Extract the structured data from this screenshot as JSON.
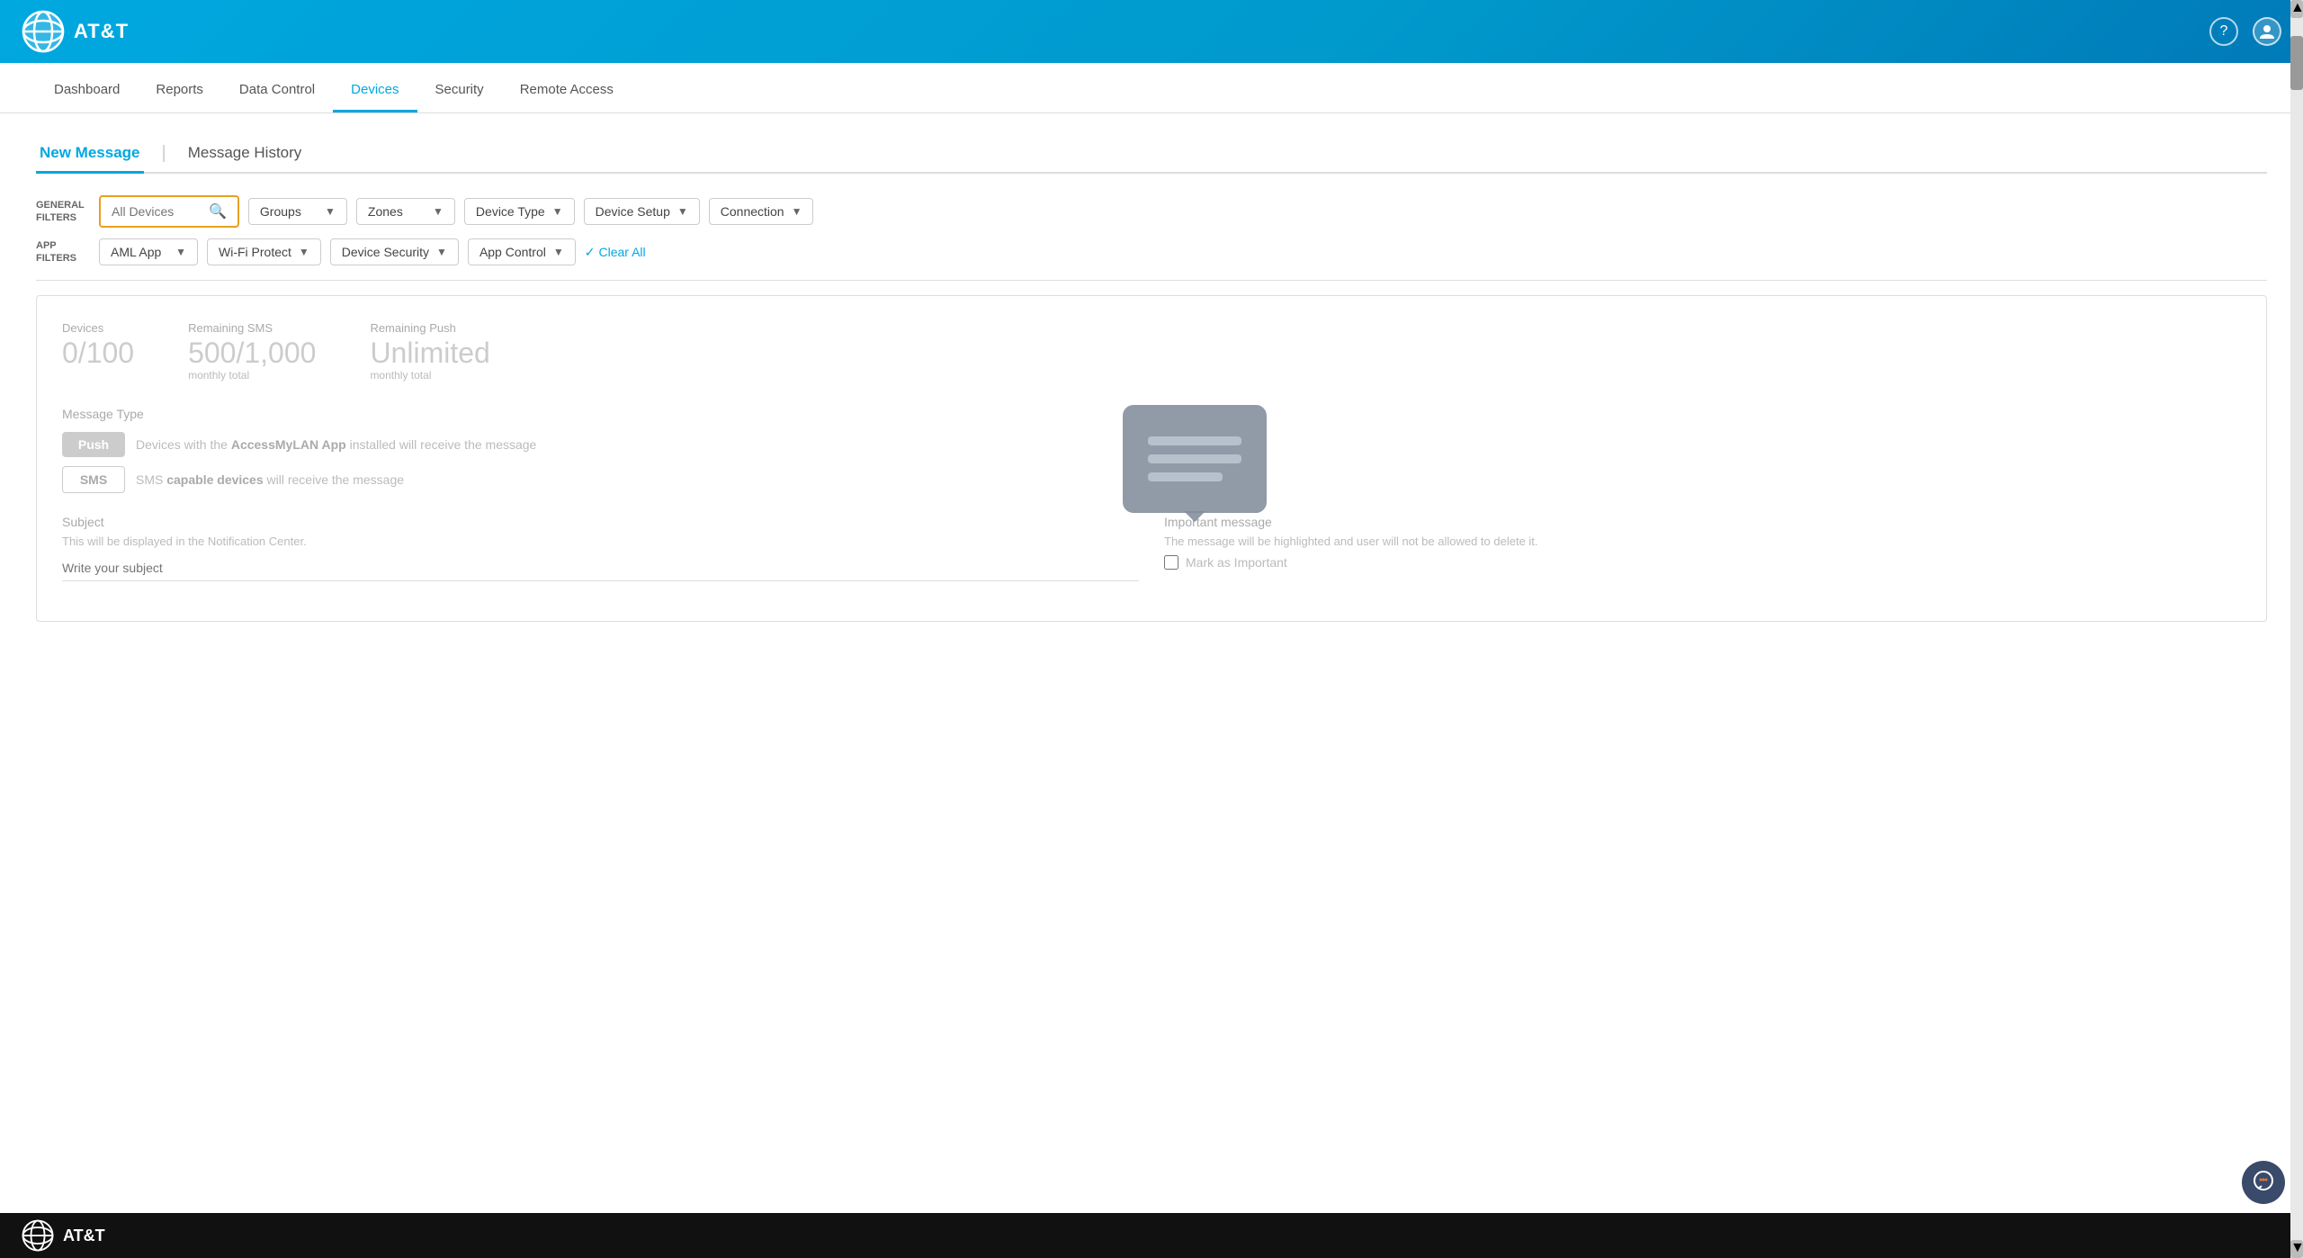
{
  "header": {
    "brand": "AT&T",
    "help_icon": "?",
    "user_icon": "👤"
  },
  "navbar": {
    "items": [
      {
        "label": "Dashboard",
        "active": false
      },
      {
        "label": "Reports",
        "active": false
      },
      {
        "label": "Data Control",
        "active": false
      },
      {
        "label": "Devices",
        "active": true
      },
      {
        "label": "Security",
        "active": false
      },
      {
        "label": "Remote Access",
        "active": false
      }
    ]
  },
  "tabs": [
    {
      "label": "New Message",
      "active": true
    },
    {
      "label": "Message History",
      "active": false
    }
  ],
  "filters": {
    "general_label": "GENERAL FILTERS",
    "app_label": "APP FILTERS",
    "search_placeholder": "All Devices",
    "general_dropdowns": [
      {
        "label": "Groups"
      },
      {
        "label": "Zones"
      },
      {
        "label": "Device Type"
      },
      {
        "label": "Device Setup"
      },
      {
        "label": "Connection"
      }
    ],
    "app_dropdowns": [
      {
        "label": "AML App"
      },
      {
        "label": "Wi-Fi Protect"
      },
      {
        "label": "Device Security"
      },
      {
        "label": "App Control"
      }
    ],
    "clear_all": "Clear All"
  },
  "stats": [
    {
      "label": "Devices",
      "value": "0/100",
      "sub": ""
    },
    {
      "label": "Remaining SMS",
      "value": "500/1,000",
      "sub": "monthly total"
    },
    {
      "label": "Remaining Push",
      "value": "Unlimited",
      "sub": "monthly total"
    }
  ],
  "message_type": {
    "label": "Message Type",
    "types": [
      {
        "btn": "Push",
        "style": "push",
        "desc_pre": "Devices with the ",
        "desc_bold": "AccessMyLAN App",
        "desc_post": " installed will receive the message"
      },
      {
        "btn": "SMS",
        "style": "sms",
        "desc_pre": "SMS ",
        "desc_bold": "capable devices",
        "desc_post": " will receive the message"
      }
    ]
  },
  "form": {
    "subject_label": "Subject",
    "subject_desc": "This will be displayed in the Notification Center.",
    "subject_placeholder": "Write your subject",
    "important_label": "Important message",
    "important_desc": "The message will be highlighted and user will not be allowed to delete it.",
    "mark_important_label": "Mark as Important"
  },
  "footer": {
    "brand": "AT&T"
  },
  "chat_bubble": {
    "lines": 3
  }
}
